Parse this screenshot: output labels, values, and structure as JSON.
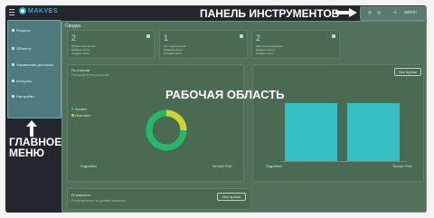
{
  "header": {
    "logo_text": "MAKVES",
    "toolbar_label": "ПАНЕЛЬ ИНСТРУМЕНТОВ",
    "toolbar_items": [
      "◎",
      "◎",
      "admin"
    ]
  },
  "sidebar": {
    "items": [
      {
        "label": "Ресурсы",
        "icon": "folder-icon"
      },
      {
        "label": "Объекты",
        "icon": "objects-icon"
      },
      {
        "label": "Управление доступом",
        "icon": "access-icon"
      },
      {
        "label": "Контроль",
        "icon": "control-icon"
      },
      {
        "label": "Настройки",
        "icon": "settings-icon"
      }
    ],
    "label_line1": "ГЛАВНОЕ",
    "label_line2": "МЕНЮ"
  },
  "workspace": {
    "title": "Сводка",
    "label": "РАБОЧАЯ ОБЛАСТЬ",
    "kpi_cards": [
      {
        "value": "2",
        "lines": [
          "Общее количество",
          "Найдено всего",
          "Создано всего"
        ]
      },
      {
        "value": "1",
        "lines": [
          "Нет подключения",
          "Найдено всего",
          "Создано всего"
        ]
      },
      {
        "value": "2",
        "lines": [
          "Зарегистрированные",
          "Найдено всего",
          "Создано всего"
        ]
      }
    ],
    "panel_left": {
      "title": "По статусам",
      "subtitle": "Распределение ресурсов",
      "legend": [
        "Активен",
        "Неактивен"
      ],
      "footer_left": "Подробнее",
      "footer_right": "Экспорт PNG"
    },
    "panel_right": {
      "button_label": "Все время",
      "footer_left": "Подробнее",
      "footer_right": "Экспорт PNG"
    },
    "panel_bottom": {
      "title": "По важности",
      "subtitle": "Распределение по уровню важности",
      "button_label": "Все время"
    }
  },
  "colors": {
    "frame_bg": "#23262c",
    "sidebar_bg": "#4f7b7e",
    "workspace_bg": "#52715c",
    "donut_green": "#26b86a",
    "donut_yellow": "#cbd632",
    "bar_color": "#35bfc5",
    "logo_blue": "#2aa6d8"
  }
}
